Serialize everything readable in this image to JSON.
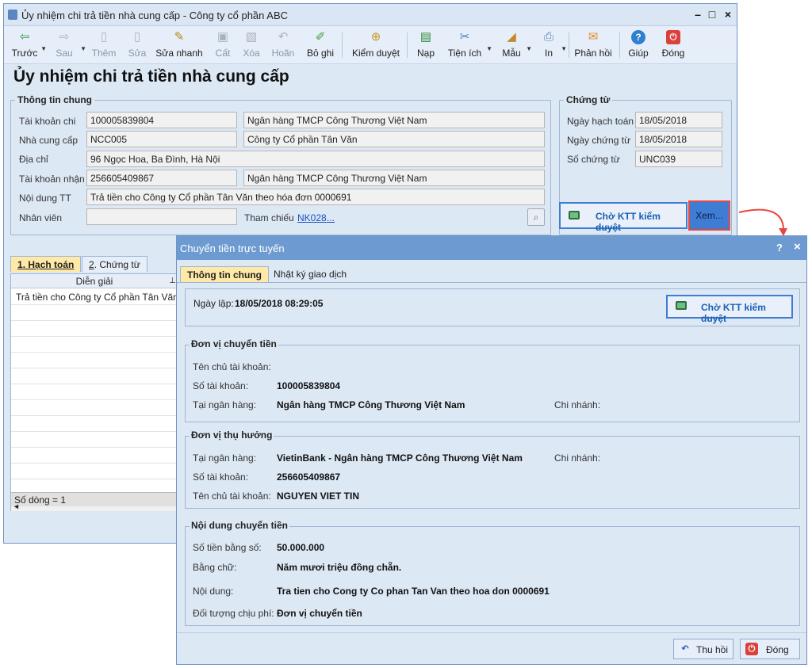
{
  "main_window": {
    "title": "Ủy nhiệm chi trả tiền nhà cung cấp - Công ty cổ phần ABC",
    "toolbar": [
      {
        "label": "Trước",
        "icon": "arrow-left-icon",
        "enabled": true
      },
      {
        "label": "Sau",
        "icon": "arrow-right-icon",
        "enabled": false
      },
      {
        "label": "Thêm",
        "icon": "add-doc-icon",
        "enabled": false
      },
      {
        "label": "Sửa",
        "icon": "edit-doc-icon",
        "enabled": false
      },
      {
        "label": "Sửa nhanh",
        "icon": "quick-edit-icon",
        "enabled": true
      },
      {
        "label": "Cất",
        "icon": "save-icon",
        "enabled": false
      },
      {
        "label": "Xóa",
        "icon": "delete-icon",
        "enabled": false
      },
      {
        "label": "Hoãn",
        "icon": "undo-icon",
        "enabled": false
      },
      {
        "label": "Bỏ ghi",
        "icon": "unpost-icon",
        "enabled": true
      },
      {
        "label": "Kiểm duyệt",
        "icon": "approve-icon",
        "enabled": true
      },
      {
        "label": "Nạp",
        "icon": "reload-icon",
        "enabled": true
      },
      {
        "label": "Tiện ích",
        "icon": "tools-icon",
        "enabled": true
      },
      {
        "label": "Mẫu",
        "icon": "template-icon",
        "enabled": true
      },
      {
        "label": "In",
        "icon": "print-icon",
        "enabled": true
      },
      {
        "label": "Phản hồi",
        "icon": "feedback-icon",
        "enabled": true
      },
      {
        "label": "Giúp",
        "icon": "help-icon",
        "enabled": true
      },
      {
        "label": "Đóng",
        "icon": "close-icon",
        "enabled": true
      }
    ],
    "form_title": "Ủy nhiệm chi trả tiền nhà cung cấp",
    "general_info": {
      "legend": "Thông tin chung",
      "account_label": "Tài khoản chi",
      "account_value": "100005839804",
      "account_bank": "Ngân hàng TMCP Công Thương Việt Nam",
      "supplier_label": "Nhà cung cấp",
      "supplier_code": "NCC005",
      "supplier_name": "Công ty Cổ phần Tân Văn",
      "address_label": "Địa chỉ",
      "address_value": "96 Ngọc Hoa, Ba Đình, Hà Nội",
      "recv_account_label": "Tài khoản nhận",
      "recv_account_value": "256605409867",
      "recv_bank": "Ngân hàng TMCP Công Thương Việt Nam",
      "content_label": "Nội dung TT",
      "content_value": "Trả tiền cho Công ty Cổ phần Tân Văn theo hóa đơn 0000691",
      "employee_label": "Nhân viên",
      "employee_value": "",
      "reference_label": "Tham chiếu",
      "reference_link": "NK028",
      "reference_more": "..."
    },
    "voucher": {
      "legend": "Chứng từ",
      "posting_date_label": "Ngày hạch toán",
      "posting_date": "18/05/2018",
      "voucher_date_label": "Ngày chứng từ",
      "voucher_date": "18/05/2018",
      "voucher_no_label": "Số chứng từ",
      "voucher_no": "UNC039"
    },
    "status_button": "Chờ KTT kiểm duyệt",
    "view_button": "Xem...",
    "tabs": [
      {
        "num": "1",
        "label": ". Hạch toán"
      },
      {
        "num": "2",
        "label": ". Chứng từ"
      }
    ],
    "grid": {
      "column": "Diễn giải",
      "rows": [
        "Trả tiền cho Công ty Cổ phần Tân Văn t"
      ],
      "footer": "Số dòng = 1"
    }
  },
  "dialog": {
    "title": "Chuyển tiền trực tuyến",
    "help": "?",
    "close": "×",
    "tabs": [
      "Thông tin chung",
      "Nhật ký giao dịch"
    ],
    "created_label": "Ngày lập:",
    "created_value": "18/05/2018 08:29:05",
    "status_button": "Chờ KTT kiểm duyệt",
    "sender": {
      "title": "Đơn vị chuyển tiền",
      "owner_label": "Tên chủ tài khoản:",
      "owner_value": "",
      "account_label": "Số tài khoản:",
      "account_value": "100005839804",
      "bank_label": "Tại ngân hàng:",
      "bank_value": "Ngân hàng TMCP Công Thương Việt Nam",
      "branch_label": "Chi nhánh:",
      "branch_value": ""
    },
    "receiver": {
      "title": "Đơn vị thụ hưởng",
      "bank_label": "Tại ngân hàng:",
      "bank_value": "VietinBank - Ngân hàng TMCP Công Thương Việt Nam",
      "branch_label": "Chi nhánh:",
      "branch_value": "",
      "account_label": "Số tài khoản:",
      "account_value": "256605409867",
      "owner_label": "Tên chủ tài khoản:",
      "owner_value": "NGUYEN VIET TIN"
    },
    "transfer": {
      "title": "Nội dung chuyển tiền",
      "amount_label": "Số tiền bằng số:",
      "amount_value": "50.000.000",
      "words_label": "Bằng chữ:",
      "words_value": "Năm mươi triệu đồng chẵn.",
      "content_label": "Nội dung:",
      "content_value": "Tra tien cho Cong ty Co phan Tan Van theo hoa don 0000691",
      "fee_label": "Đối tượng chịu phí:",
      "fee_value": "Đơn vị chuyển tiền"
    },
    "revoke_button": "Thu hồi",
    "close_button": "Đóng"
  },
  "colors": {
    "accent": "#3f7dd4",
    "highlight": "#e8473f",
    "dialog_title": "#6d9bd1"
  }
}
